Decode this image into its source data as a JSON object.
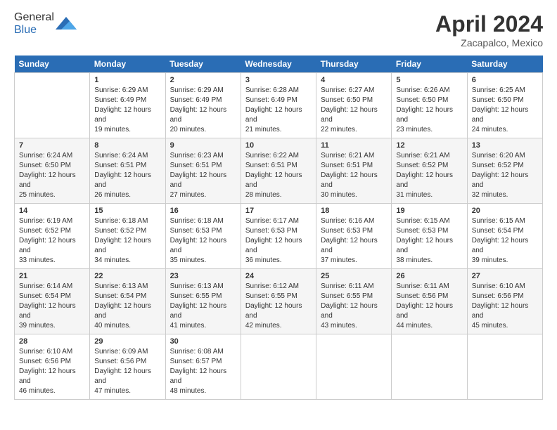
{
  "header": {
    "logo_general": "General",
    "logo_blue": "Blue",
    "title": "April 2024",
    "subtitle": "Zacapalco, Mexico"
  },
  "columns": [
    "Sunday",
    "Monday",
    "Tuesday",
    "Wednesday",
    "Thursday",
    "Friday",
    "Saturday"
  ],
  "weeks": [
    [
      {
        "day": "",
        "sunrise": "",
        "sunset": "",
        "daylight": ""
      },
      {
        "day": "1",
        "sunrise": "Sunrise: 6:29 AM",
        "sunset": "Sunset: 6:49 PM",
        "daylight": "Daylight: 12 hours and 19 minutes."
      },
      {
        "day": "2",
        "sunrise": "Sunrise: 6:29 AM",
        "sunset": "Sunset: 6:49 PM",
        "daylight": "Daylight: 12 hours and 20 minutes."
      },
      {
        "day": "3",
        "sunrise": "Sunrise: 6:28 AM",
        "sunset": "Sunset: 6:49 PM",
        "daylight": "Daylight: 12 hours and 21 minutes."
      },
      {
        "day": "4",
        "sunrise": "Sunrise: 6:27 AM",
        "sunset": "Sunset: 6:50 PM",
        "daylight": "Daylight: 12 hours and 22 minutes."
      },
      {
        "day": "5",
        "sunrise": "Sunrise: 6:26 AM",
        "sunset": "Sunset: 6:50 PM",
        "daylight": "Daylight: 12 hours and 23 minutes."
      },
      {
        "day": "6",
        "sunrise": "Sunrise: 6:25 AM",
        "sunset": "Sunset: 6:50 PM",
        "daylight": "Daylight: 12 hours and 24 minutes."
      }
    ],
    [
      {
        "day": "7",
        "sunrise": "Sunrise: 6:24 AM",
        "sunset": "Sunset: 6:50 PM",
        "daylight": "Daylight: 12 hours and 25 minutes."
      },
      {
        "day": "8",
        "sunrise": "Sunrise: 6:24 AM",
        "sunset": "Sunset: 6:51 PM",
        "daylight": "Daylight: 12 hours and 26 minutes."
      },
      {
        "day": "9",
        "sunrise": "Sunrise: 6:23 AM",
        "sunset": "Sunset: 6:51 PM",
        "daylight": "Daylight: 12 hours and 27 minutes."
      },
      {
        "day": "10",
        "sunrise": "Sunrise: 6:22 AM",
        "sunset": "Sunset: 6:51 PM",
        "daylight": "Daylight: 12 hours and 28 minutes."
      },
      {
        "day": "11",
        "sunrise": "Sunrise: 6:21 AM",
        "sunset": "Sunset: 6:51 PM",
        "daylight": "Daylight: 12 hours and 30 minutes."
      },
      {
        "day": "12",
        "sunrise": "Sunrise: 6:21 AM",
        "sunset": "Sunset: 6:52 PM",
        "daylight": "Daylight: 12 hours and 31 minutes."
      },
      {
        "day": "13",
        "sunrise": "Sunrise: 6:20 AM",
        "sunset": "Sunset: 6:52 PM",
        "daylight": "Daylight: 12 hours and 32 minutes."
      }
    ],
    [
      {
        "day": "14",
        "sunrise": "Sunrise: 6:19 AM",
        "sunset": "Sunset: 6:52 PM",
        "daylight": "Daylight: 12 hours and 33 minutes."
      },
      {
        "day": "15",
        "sunrise": "Sunrise: 6:18 AM",
        "sunset": "Sunset: 6:52 PM",
        "daylight": "Daylight: 12 hours and 34 minutes."
      },
      {
        "day": "16",
        "sunrise": "Sunrise: 6:18 AM",
        "sunset": "Sunset: 6:53 PM",
        "daylight": "Daylight: 12 hours and 35 minutes."
      },
      {
        "day": "17",
        "sunrise": "Sunrise: 6:17 AM",
        "sunset": "Sunset: 6:53 PM",
        "daylight": "Daylight: 12 hours and 36 minutes."
      },
      {
        "day": "18",
        "sunrise": "Sunrise: 6:16 AM",
        "sunset": "Sunset: 6:53 PM",
        "daylight": "Daylight: 12 hours and 37 minutes."
      },
      {
        "day": "19",
        "sunrise": "Sunrise: 6:15 AM",
        "sunset": "Sunset: 6:53 PM",
        "daylight": "Daylight: 12 hours and 38 minutes."
      },
      {
        "day": "20",
        "sunrise": "Sunrise: 6:15 AM",
        "sunset": "Sunset: 6:54 PM",
        "daylight": "Daylight: 12 hours and 39 minutes."
      }
    ],
    [
      {
        "day": "21",
        "sunrise": "Sunrise: 6:14 AM",
        "sunset": "Sunset: 6:54 PM",
        "daylight": "Daylight: 12 hours and 39 minutes."
      },
      {
        "day": "22",
        "sunrise": "Sunrise: 6:13 AM",
        "sunset": "Sunset: 6:54 PM",
        "daylight": "Daylight: 12 hours and 40 minutes."
      },
      {
        "day": "23",
        "sunrise": "Sunrise: 6:13 AM",
        "sunset": "Sunset: 6:55 PM",
        "daylight": "Daylight: 12 hours and 41 minutes."
      },
      {
        "day": "24",
        "sunrise": "Sunrise: 6:12 AM",
        "sunset": "Sunset: 6:55 PM",
        "daylight": "Daylight: 12 hours and 42 minutes."
      },
      {
        "day": "25",
        "sunrise": "Sunrise: 6:11 AM",
        "sunset": "Sunset: 6:55 PM",
        "daylight": "Daylight: 12 hours and 43 minutes."
      },
      {
        "day": "26",
        "sunrise": "Sunrise: 6:11 AM",
        "sunset": "Sunset: 6:56 PM",
        "daylight": "Daylight: 12 hours and 44 minutes."
      },
      {
        "day": "27",
        "sunrise": "Sunrise: 6:10 AM",
        "sunset": "Sunset: 6:56 PM",
        "daylight": "Daylight: 12 hours and 45 minutes."
      }
    ],
    [
      {
        "day": "28",
        "sunrise": "Sunrise: 6:10 AM",
        "sunset": "Sunset: 6:56 PM",
        "daylight": "Daylight: 12 hours and 46 minutes."
      },
      {
        "day": "29",
        "sunrise": "Sunrise: 6:09 AM",
        "sunset": "Sunset: 6:56 PM",
        "daylight": "Daylight: 12 hours and 47 minutes."
      },
      {
        "day": "30",
        "sunrise": "Sunrise: 6:08 AM",
        "sunset": "Sunset: 6:57 PM",
        "daylight": "Daylight: 12 hours and 48 minutes."
      },
      {
        "day": "",
        "sunrise": "",
        "sunset": "",
        "daylight": ""
      },
      {
        "day": "",
        "sunrise": "",
        "sunset": "",
        "daylight": ""
      },
      {
        "day": "",
        "sunrise": "",
        "sunset": "",
        "daylight": ""
      },
      {
        "day": "",
        "sunrise": "",
        "sunset": "",
        "daylight": ""
      }
    ]
  ]
}
